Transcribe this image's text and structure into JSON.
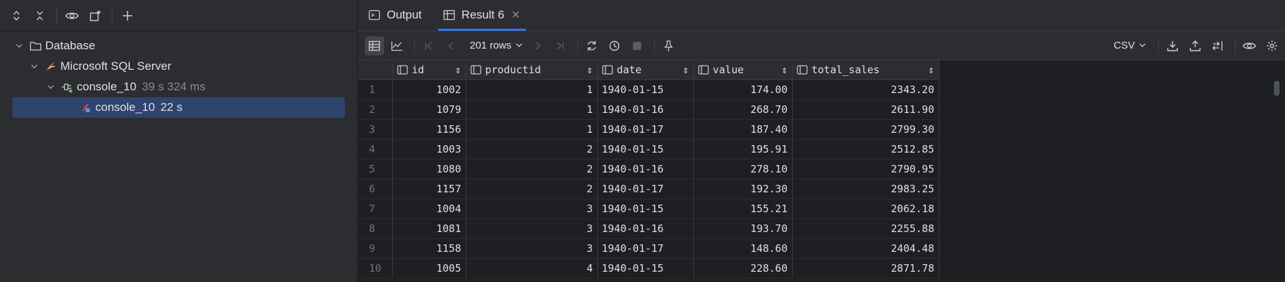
{
  "left_panel": {
    "tree": [
      {
        "label": "Database",
        "extra": ""
      },
      {
        "label": "Microsoft SQL Server",
        "extra": ""
      },
      {
        "label": "console_10",
        "extra": "39 s 324 ms"
      },
      {
        "label": "console_10",
        "extra": "22 s"
      }
    ]
  },
  "tabs": [
    {
      "label": "Output"
    },
    {
      "label": "Result 6"
    }
  ],
  "toolbar": {
    "rows_label": "201 rows",
    "export_format": "CSV"
  },
  "table": {
    "columns": [
      "id",
      "productid",
      "date",
      "value",
      "total_sales"
    ],
    "rows": [
      {
        "n": "1",
        "id": "1002",
        "productid": "1",
        "date": "1940-01-15",
        "value": "174.00",
        "total_sales": "2343.20"
      },
      {
        "n": "2",
        "id": "1079",
        "productid": "1",
        "date": "1940-01-16",
        "value": "268.70",
        "total_sales": "2611.90"
      },
      {
        "n": "3",
        "id": "1156",
        "productid": "1",
        "date": "1940-01-17",
        "value": "187.40",
        "total_sales": "2799.30"
      },
      {
        "n": "4",
        "id": "1003",
        "productid": "2",
        "date": "1940-01-15",
        "value": "195.91",
        "total_sales": "2512.85"
      },
      {
        "n": "5",
        "id": "1080",
        "productid": "2",
        "date": "1940-01-16",
        "value": "278.10",
        "total_sales": "2790.95"
      },
      {
        "n": "6",
        "id": "1157",
        "productid": "2",
        "date": "1940-01-17",
        "value": "192.30",
        "total_sales": "2983.25"
      },
      {
        "n": "7",
        "id": "1004",
        "productid": "3",
        "date": "1940-01-15",
        "value": "155.21",
        "total_sales": "2062.18"
      },
      {
        "n": "8",
        "id": "1081",
        "productid": "3",
        "date": "1940-01-16",
        "value": "193.70",
        "total_sales": "2255.88"
      },
      {
        "n": "9",
        "id": "1158",
        "productid": "3",
        "date": "1940-01-17",
        "value": "148.60",
        "total_sales": "2404.48"
      },
      {
        "n": "10",
        "id": "1005",
        "productid": "4",
        "date": "1940-01-15",
        "value": "228.60",
        "total_sales": "2871.78"
      }
    ]
  },
  "colors": {
    "selection": "#2e436e",
    "accent": "#3574f0"
  }
}
